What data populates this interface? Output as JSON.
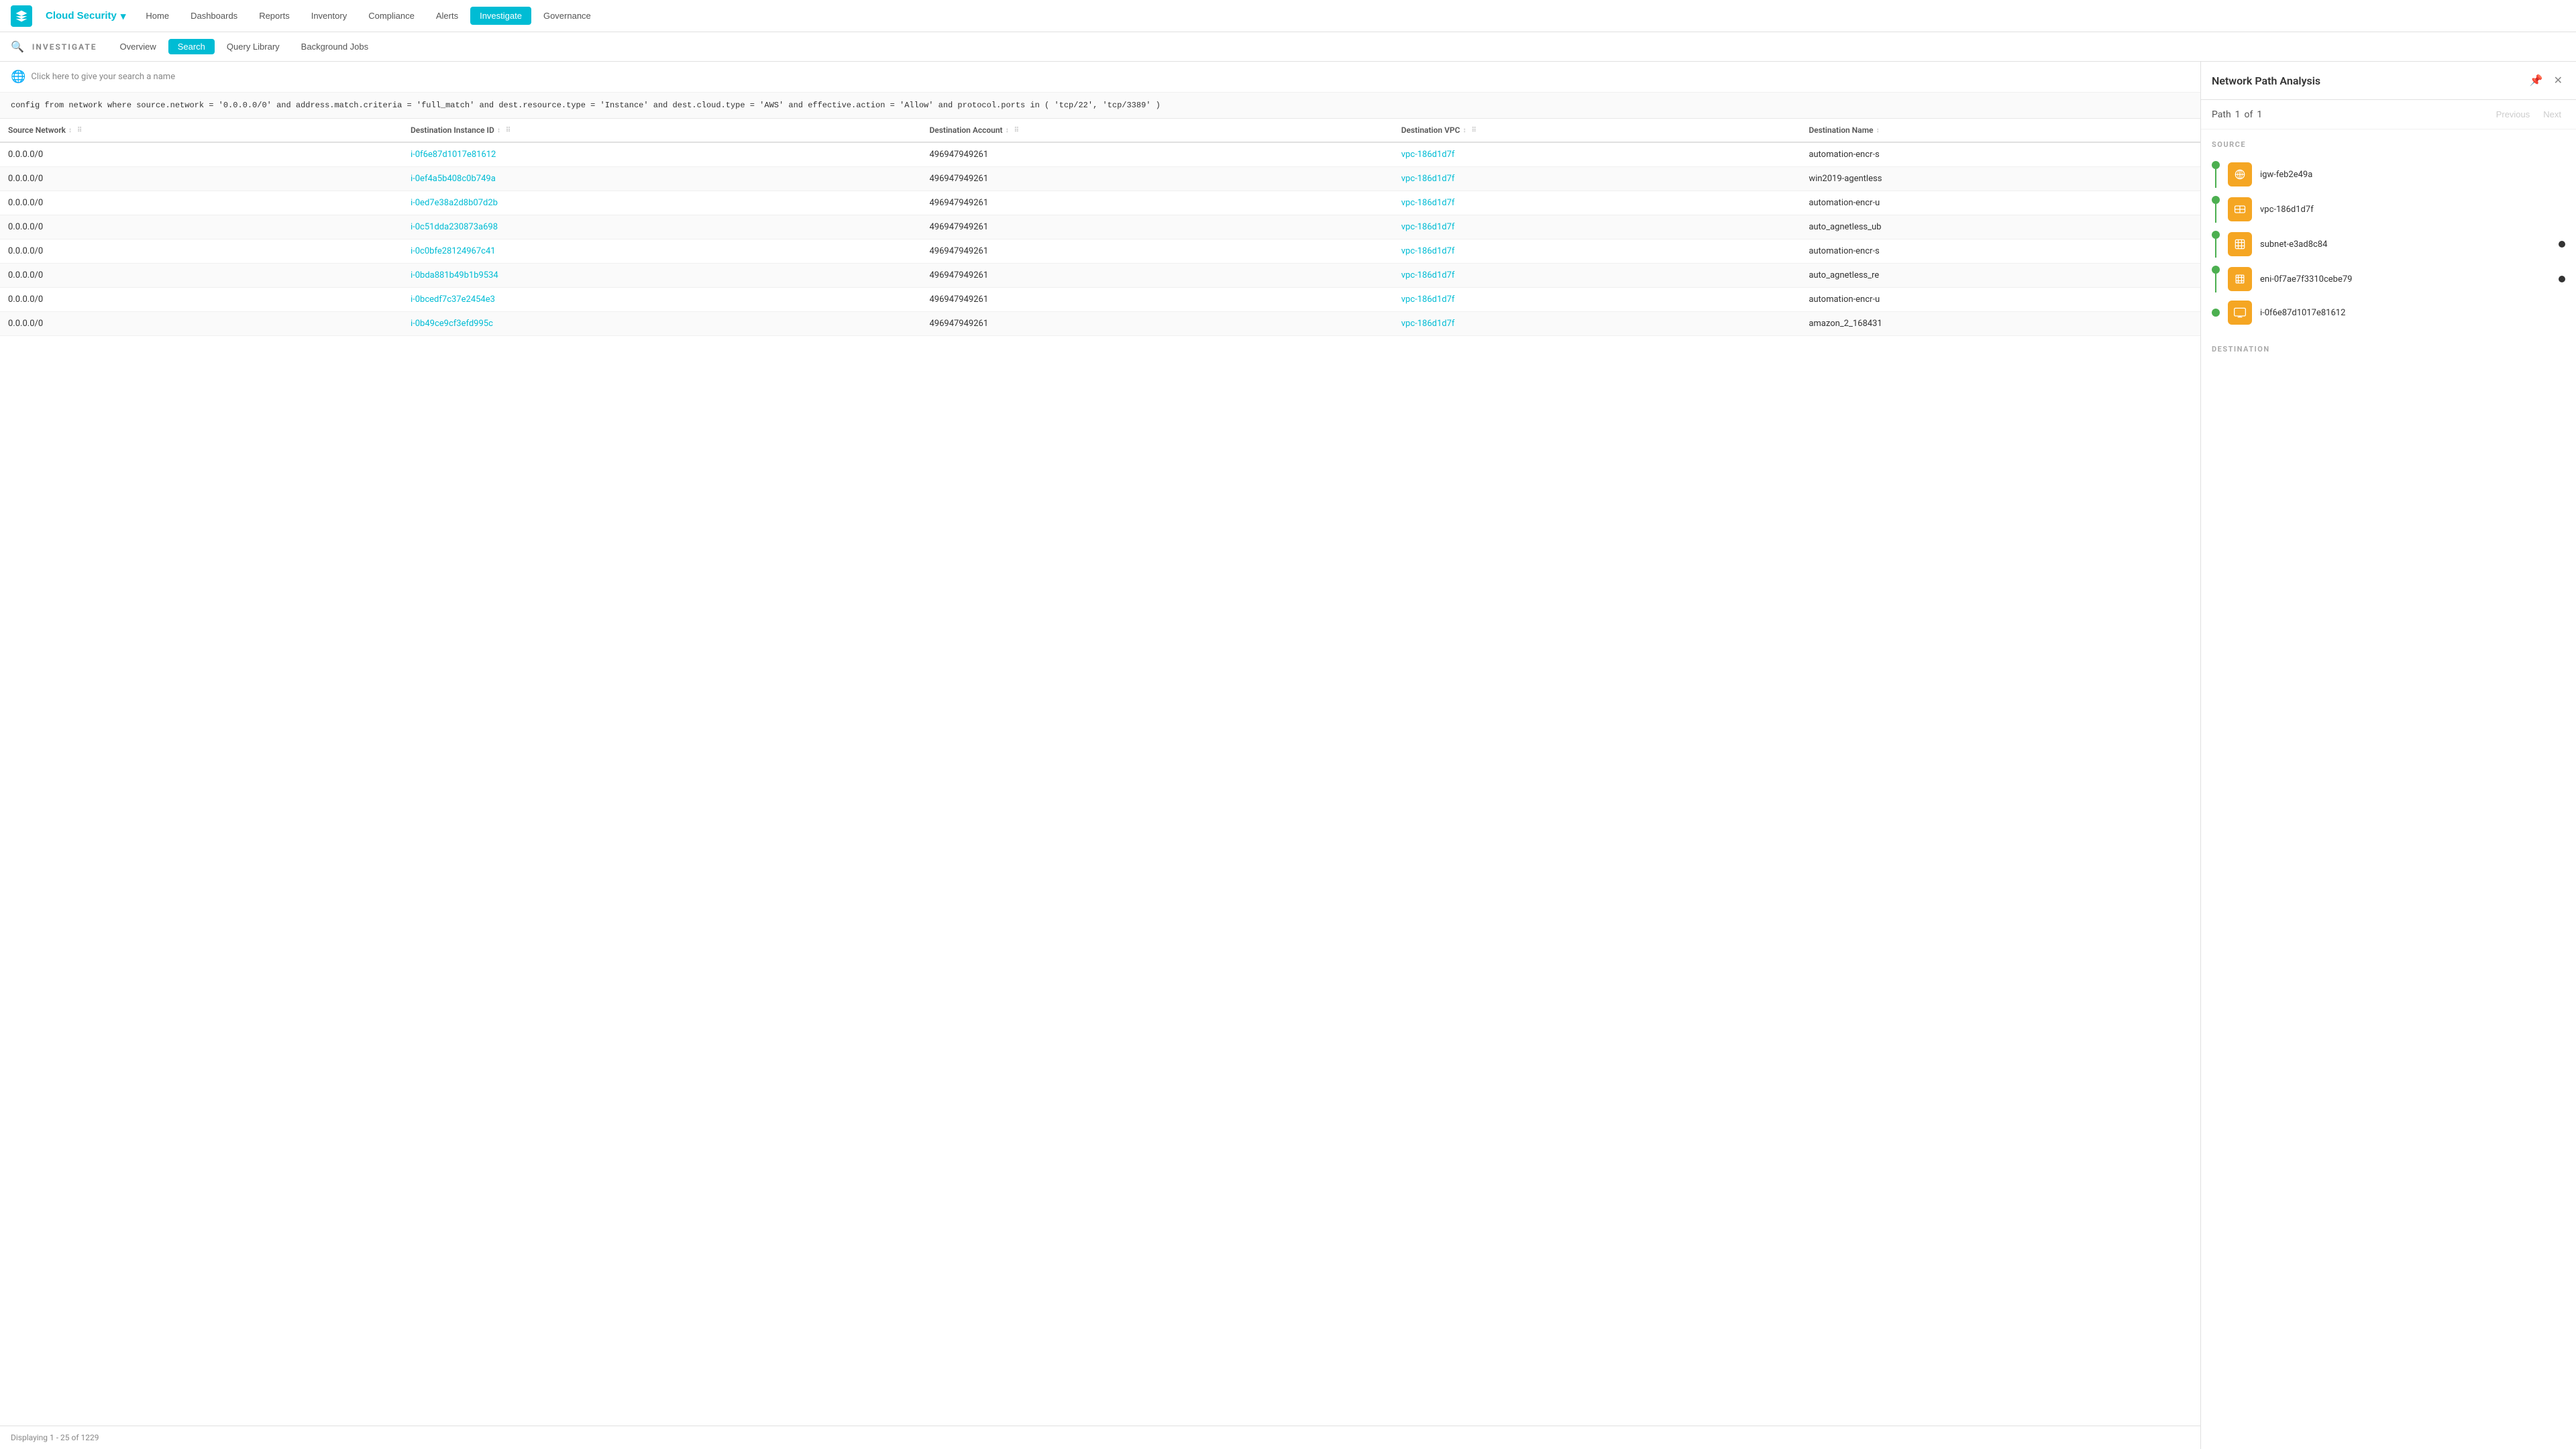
{
  "app": {
    "logo_alt": "Prisma logo",
    "brand": "Cloud Security",
    "brand_chevron": "▾"
  },
  "top_nav": {
    "links": [
      {
        "id": "home",
        "label": "Home",
        "active": false
      },
      {
        "id": "dashboards",
        "label": "Dashboards",
        "active": false
      },
      {
        "id": "reports",
        "label": "Reports",
        "active": false
      },
      {
        "id": "inventory",
        "label": "Inventory",
        "active": false
      },
      {
        "id": "compliance",
        "label": "Compliance",
        "active": false
      },
      {
        "id": "alerts",
        "label": "Alerts",
        "active": false
      },
      {
        "id": "investigate",
        "label": "Investigate",
        "active": true
      },
      {
        "id": "governance",
        "label": "Governance",
        "active": false
      }
    ]
  },
  "sub_nav": {
    "search_icon": "🔍",
    "label": "INVESTIGATE",
    "tabs": [
      {
        "id": "overview",
        "label": "Overview",
        "active": false
      },
      {
        "id": "search",
        "label": "Search",
        "active": true
      },
      {
        "id": "query_library",
        "label": "Query Library",
        "active": false
      },
      {
        "id": "background_jobs",
        "label": "Background Jobs",
        "active": false
      }
    ]
  },
  "search_bar": {
    "globe_icon": "🌐",
    "placeholder_text": "Click here to give your search a name"
  },
  "query": {
    "text": "config from network where source.network = '0.0.0.0/0' and address.match.criteria = 'full_match' and dest.resource.type = 'Instance' and dest.cloud.type = 'AWS' and effective.action = 'Allow' and protocol.ports in ( 'tcp/22', 'tcp/3389' )"
  },
  "table": {
    "columns": [
      {
        "id": "source_network",
        "label": "Source Network",
        "sortable": true
      },
      {
        "id": "destination_instance_id",
        "label": "Destination Instance ID",
        "sortable": true
      },
      {
        "id": "destination_account",
        "label": "Destination Account",
        "sortable": true
      },
      {
        "id": "destination_vpc",
        "label": "Destination VPC",
        "sortable": true
      },
      {
        "id": "destination_name",
        "label": "Destination Name",
        "sortable": true
      }
    ],
    "rows": [
      {
        "source_network": "0.0.0.0/0",
        "dest_instance_id": "i-0f6e87d1017e81612",
        "dest_account": "496947949261",
        "dest_vpc": "vpc-186d1d7f",
        "dest_name": "automation-encr-s"
      },
      {
        "source_network": "0.0.0.0/0",
        "dest_instance_id": "i-0ef4a5b408c0b749a",
        "dest_account": "496947949261",
        "dest_vpc": "vpc-186d1d7f",
        "dest_name": "win2019-agentless"
      },
      {
        "source_network": "0.0.0.0/0",
        "dest_instance_id": "i-0ed7e38a2d8b07d2b",
        "dest_account": "496947949261",
        "dest_vpc": "vpc-186d1d7f",
        "dest_name": "automation-encr-u"
      },
      {
        "source_network": "0.0.0.0/0",
        "dest_instance_id": "i-0c51dda230873a698",
        "dest_account": "496947949261",
        "dest_vpc": "vpc-186d1d7f",
        "dest_name": "auto_agnetless_ub"
      },
      {
        "source_network": "0.0.0.0/0",
        "dest_instance_id": "i-0c0bfe28124967c41",
        "dest_account": "496947949261",
        "dest_vpc": "vpc-186d1d7f",
        "dest_name": "automation-encr-s"
      },
      {
        "source_network": "0.0.0.0/0",
        "dest_instance_id": "i-0bda881b49b1b9534",
        "dest_account": "496947949261",
        "dest_vpc": "vpc-186d1d7f",
        "dest_name": "auto_agnetless_re"
      },
      {
        "source_network": "0.0.0.0/0",
        "dest_instance_id": "i-0bcedf7c37e2454e3",
        "dest_account": "496947949261",
        "dest_vpc": "vpc-186d1d7f",
        "dest_name": "automation-encr-u"
      },
      {
        "source_network": "0.0.0.0/0",
        "dest_instance_id": "i-0b49ce9cf3efd995c",
        "dest_account": "496947949261",
        "dest_vpc": "vpc-186d1d7f",
        "dest_name": "amazon_2_168431"
      }
    ],
    "footer": "Displaying 1 - 25 of 1229"
  },
  "right_panel": {
    "title": "Network Path Analysis",
    "pin_icon": "📌",
    "close_icon": "✕",
    "path_label": "Path",
    "path_current": "1",
    "path_of": "of",
    "path_total": "1",
    "prev_label": "Previous",
    "next_label": "Next",
    "source_section_label": "SOURCE",
    "destination_section_label": "DESTINATION",
    "nodes": [
      {
        "id": "igw",
        "label": "igw-feb2e49a",
        "icon_type": "gateway",
        "has_line": true,
        "has_bullet": false
      },
      {
        "id": "vpc",
        "label": "vpc-186d1d7f",
        "icon_type": "vpc",
        "has_line": true,
        "has_bullet": false
      },
      {
        "id": "subnet",
        "label": "subnet-e3ad8c84",
        "icon_type": "subnet",
        "has_line": true,
        "has_bullet": true
      },
      {
        "id": "eni",
        "label": "eni-0f7ae7f3310cebe79",
        "icon_type": "eni",
        "has_line": true,
        "has_bullet": true
      },
      {
        "id": "instance",
        "label": "i-0f6e87d1017e81612",
        "icon_type": "instance",
        "has_line": false,
        "has_bullet": false
      }
    ]
  }
}
